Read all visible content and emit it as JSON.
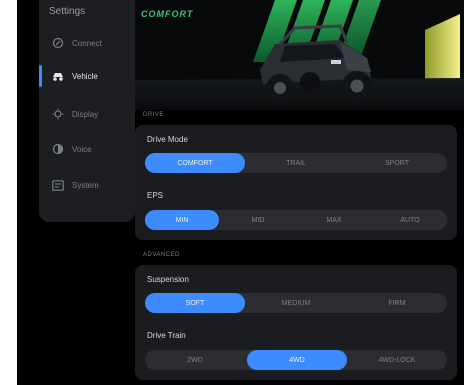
{
  "sidebar": {
    "title": "Settings",
    "items": [
      {
        "label": "Connect",
        "icon": "connect-icon"
      },
      {
        "label": "Vehicle",
        "icon": "vehicle-icon",
        "active": true
      },
      {
        "label": "Display",
        "icon": "display-icon"
      },
      {
        "label": "Voice",
        "icon": "voice-icon"
      },
      {
        "label": "System",
        "icon": "system-icon"
      }
    ]
  },
  "hero": {
    "brand": "COMFORT"
  },
  "sections": {
    "drive": "DRIVE",
    "advanced": "ADVANCED"
  },
  "drive_mode": {
    "title": "Drive Mode",
    "options": [
      "COMFORT",
      "TRAIL",
      "SPORT"
    ],
    "selected": "COMFORT"
  },
  "eps": {
    "title": "EPS",
    "options": [
      "MIN",
      "MID",
      "MAX",
      "AUTO"
    ],
    "selected": "MIN"
  },
  "suspension": {
    "title": "Suspension",
    "options": [
      "SOFT",
      "MEDIUM",
      "FIRM"
    ],
    "selected": "SOFT"
  },
  "drive_train": {
    "title": "Drive Train",
    "options": [
      "2WD",
      "4WD",
      "4WD-LOCK"
    ],
    "selected": "4WD"
  },
  "colors": {
    "accent": "#3d8cff",
    "brand_green": "#39c47d",
    "card": "#1b1c20",
    "background": "#000000"
  }
}
